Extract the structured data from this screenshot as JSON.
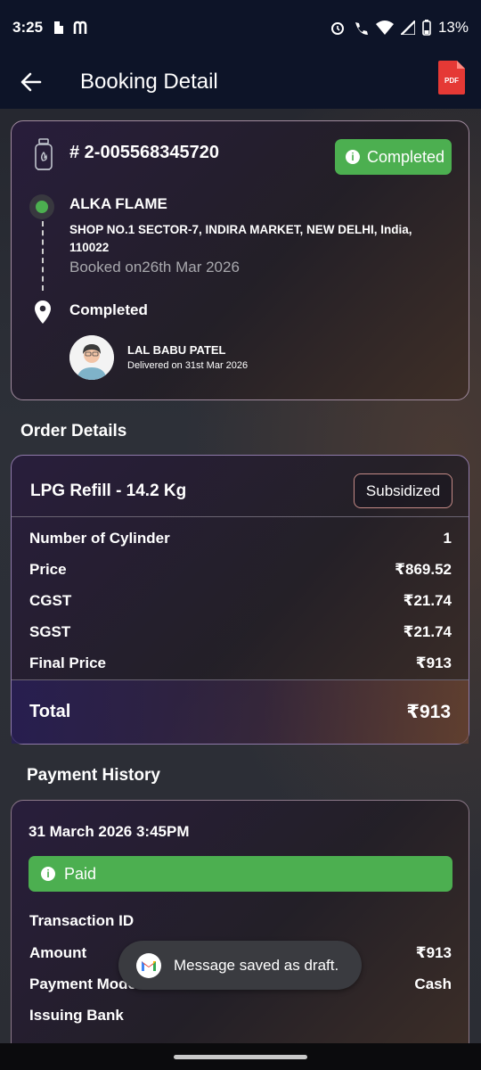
{
  "status_bar": {
    "time": "3:25",
    "battery": "13%"
  },
  "app_bar": {
    "title": "Booking Detail",
    "pdf_label": "PDF"
  },
  "booking": {
    "id": "# 2-005568345720",
    "status": "Completed",
    "dealer_name": "ALKA FLAME",
    "dealer_address": "SHOP NO.1 SECTOR-7, INDIRA MARKET, NEW DELHI, India, 110022",
    "booked_on": "Booked on26th Mar 2026",
    "delivery_status": "Completed",
    "delivery_person": "LAL BABU PATEL",
    "delivered_on": "Delivered on 31st Mar 2026"
  },
  "order": {
    "section_title": "Order Details",
    "product": "LPG Refill - 14.2 Kg",
    "badge": "Subsidized",
    "rows": [
      {
        "label": "Number of Cylinder",
        "value": "1"
      },
      {
        "label": "Price",
        "value": "₹869.52"
      },
      {
        "label": "CGST",
        "value": "₹21.74"
      },
      {
        "label": "SGST",
        "value": "₹21.74"
      },
      {
        "label": "Final Price",
        "value": "₹913"
      }
    ],
    "total_label": "Total",
    "total_value": "₹913"
  },
  "payment": {
    "section_title": "Payment History",
    "date": "31 March 2026 3:45PM",
    "status": "Paid",
    "rows": [
      {
        "label": "Transaction ID",
        "value": ""
      },
      {
        "label": "Amount",
        "value": "₹913"
      },
      {
        "label": "Payment Mode",
        "value": "Cash"
      },
      {
        "label": "Issuing Bank",
        "value": ""
      }
    ]
  },
  "toast": {
    "message": "Message saved as draft."
  },
  "colors": {
    "app_bar": "#0d1428",
    "success": "#4caf50",
    "pdf_red": "#e53935"
  }
}
